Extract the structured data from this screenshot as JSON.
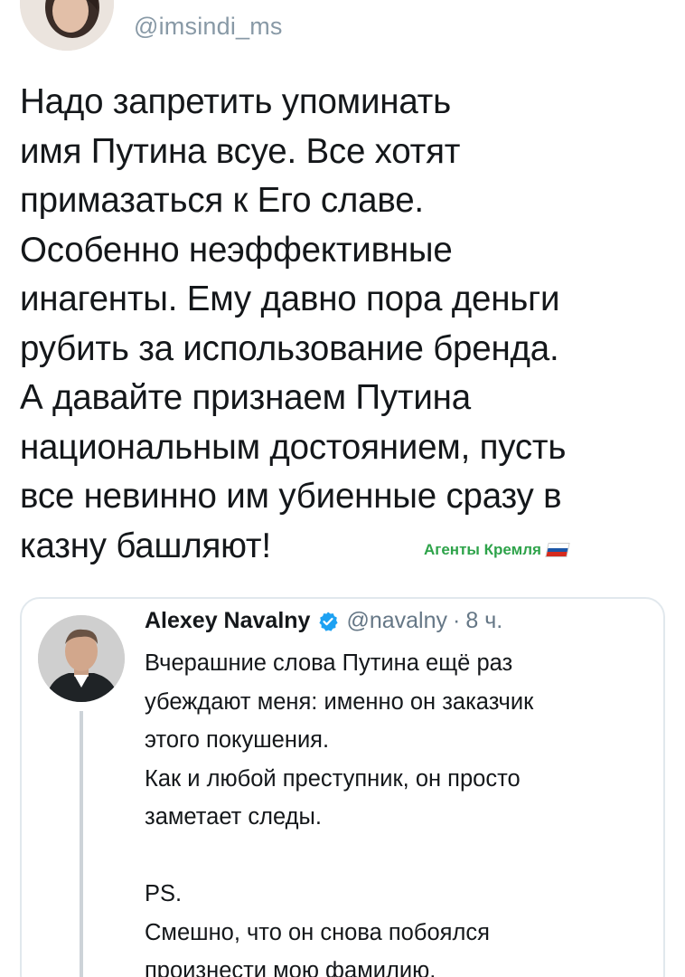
{
  "tweet": {
    "handle": "@imsindi_ms",
    "lines": [
      "Надо запретить упоминать",
      "имя Путина всуе. Все хотят",
      "примазаться к Его славе.",
      "Особенно неэффективные",
      "инагенты. Ему давно пора деньги",
      "рубить за использование бренда.",
      "А давайте признаем Путина",
      "национальным достоянием, пусть",
      "все невинно им убиенные сразу в",
      "казну башляют!"
    ]
  },
  "watermark": {
    "text": "Агенты Кремля",
    "flag_colors": [
      "#ffffff",
      "#1c57a7",
      "#d52b1e"
    ]
  },
  "quoted_tweet": {
    "name": "Alexey Navalny",
    "handle": "@navalny",
    "separator": "·",
    "time": "8 ч.",
    "verified_color": "#1da1f2",
    "lines": [
      "Вчерашние слова Путина ещё раз",
      "убеждают меня: именно он заказчик",
      "этого покушения.",
      "Как и любой преступник, он просто",
      "заметает следы.",
      "",
      "PS.",
      "Смешно, что он снова побоялся",
      "произнести мою фамилию."
    ]
  },
  "colors": {
    "text": "#14171a",
    "secondary": "#8899a6",
    "border": "#e1e8ed",
    "watermark": "#2ea34a"
  }
}
